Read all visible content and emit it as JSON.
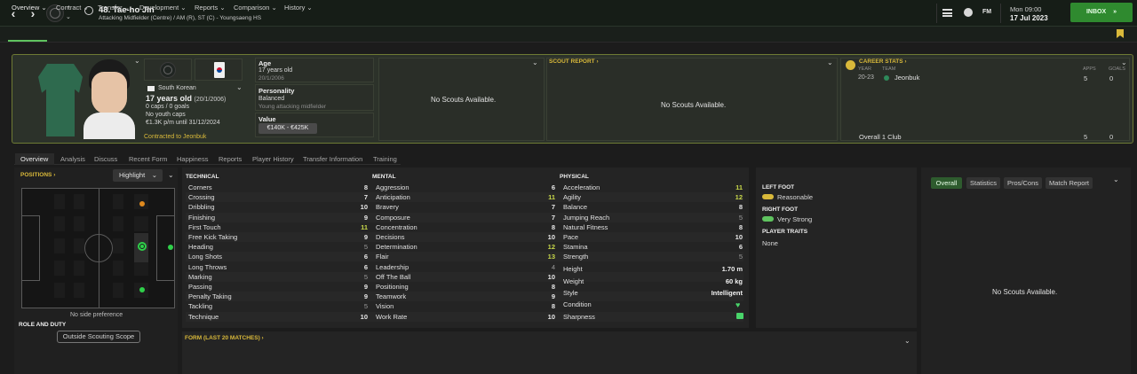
{
  "player": {
    "title": "48. Tae-ho Jin",
    "subtitle": "Attacking Midfielder (Centre) / AM (R), ST (C) - Youngsaeng HS",
    "nationality": "South Korean",
    "age_line": "17 years old",
    "dob_paren": "(20/1/2006)",
    "caps": "0 caps / 0 goals",
    "youth_caps": "No youth caps",
    "wage": "€1.3K p/m until 31/12/2024",
    "contracted": "Contracted to Jeonbuk"
  },
  "header": {
    "date_day": "Mon 09:00",
    "date_full": "17 Jul 2023",
    "inbox_label": "INBOX",
    "fm_label": "FM"
  },
  "menu": [
    "Overview",
    "Contract",
    "Transfer",
    "Development",
    "Reports",
    "Comparison",
    "History"
  ],
  "info": {
    "age_label": "Age",
    "age_value": "17 years old",
    "dob": "20/1/2006",
    "personality_label": "Personality",
    "personality_value": "Balanced",
    "personality_desc": "Young attacking midfielder",
    "value_label": "Value",
    "value_range": "€140K - €425K"
  },
  "scouts": {
    "no_scouts_1": "No Scouts Available.",
    "scout_report_label": "SCOUT REPORT",
    "no_scouts_2": "No Scouts Available.",
    "no_scouts_3": "No Scouts Available."
  },
  "career": {
    "label": "CAREER STATS",
    "col_year": "YEAR",
    "col_team": "TEAM",
    "col_apps": "APPS",
    "col_goals": "GOALS",
    "row_year": "20-23",
    "row_team": "Jeonbuk",
    "row_apps": "5",
    "row_goals": "0",
    "total_label": "Overall 1 Club",
    "total_apps": "5",
    "total_goals": "0"
  },
  "subtabs": [
    "Overview",
    "Analysis",
    "Discuss",
    "Recent Form",
    "Happiness",
    "Reports",
    "Player History",
    "Transfer Information",
    "Training"
  ],
  "positions": {
    "label": "POSITIONS",
    "highlight": "Highlight",
    "no_side": "No side preference",
    "role_label": "ROLE AND DUTY",
    "scope_button": "Outside Scouting Scope"
  },
  "attributes": {
    "technical_label": "TECHNICAL",
    "mental_label": "MENTAL",
    "physical_label": "PHYSICAL",
    "technical": [
      {
        "name": "Corners",
        "value": "8"
      },
      {
        "name": "Crossing",
        "value": "7"
      },
      {
        "name": "Dribbling",
        "value": "10"
      },
      {
        "name": "Finishing",
        "value": "9"
      },
      {
        "name": "First Touch",
        "value": "11"
      },
      {
        "name": "Free Kick Taking",
        "value": "9"
      },
      {
        "name": "Heading",
        "value": "5"
      },
      {
        "name": "Long Shots",
        "value": "6"
      },
      {
        "name": "Long Throws",
        "value": "6"
      },
      {
        "name": "Marking",
        "value": "5"
      },
      {
        "name": "Passing",
        "value": "9"
      },
      {
        "name": "Penalty Taking",
        "value": "9"
      },
      {
        "name": "Tackling",
        "value": "5"
      },
      {
        "name": "Technique",
        "value": "10"
      }
    ],
    "mental": [
      {
        "name": "Aggression",
        "value": "6"
      },
      {
        "name": "Anticipation",
        "value": "11"
      },
      {
        "name": "Bravery",
        "value": "7"
      },
      {
        "name": "Composure",
        "value": "7"
      },
      {
        "name": "Concentration",
        "value": "8"
      },
      {
        "name": "Decisions",
        "value": "10"
      },
      {
        "name": "Determination",
        "value": "12"
      },
      {
        "name": "Flair",
        "value": "13"
      },
      {
        "name": "Leadership",
        "value": "4"
      },
      {
        "name": "Off The Ball",
        "value": "10"
      },
      {
        "name": "Positioning",
        "value": "8"
      },
      {
        "name": "Teamwork",
        "value": "9"
      },
      {
        "name": "Vision",
        "value": "8"
      },
      {
        "name": "Work Rate",
        "value": "10"
      }
    ],
    "physical": [
      {
        "name": "Acceleration",
        "value": "11"
      },
      {
        "name": "Agility",
        "value": "12"
      },
      {
        "name": "Balance",
        "value": "8"
      },
      {
        "name": "Jumping Reach",
        "value": "5"
      },
      {
        "name": "Natural Fitness",
        "value": "8"
      },
      {
        "name": "Pace",
        "value": "10"
      },
      {
        "name": "Stamina",
        "value": "6"
      },
      {
        "name": "Strength",
        "value": "5"
      }
    ],
    "extra": [
      {
        "name": "Height",
        "value": "1.70 m"
      },
      {
        "name": "Weight",
        "value": "60 kg"
      },
      {
        "name": "Style",
        "value": "Intelligent"
      },
      {
        "name": "Condition",
        "value": ""
      },
      {
        "name": "Sharpness",
        "value": ""
      }
    ]
  },
  "feet": {
    "left_label": "LEFT FOOT",
    "left_value": "Reasonable",
    "right_label": "RIGHT FOOT",
    "right_value": "Very Strong",
    "traits_label": "PLAYER TRAITS",
    "traits_value": "None"
  },
  "form": {
    "label": "FORM (LAST 20 MATCHES)"
  },
  "right_tabs": [
    "Overall",
    "Statistics",
    "Pros/Cons",
    "Match Report"
  ],
  "colors": {
    "accent_green": "#5fc35f",
    "highlight_yellow": "#d9b93a",
    "attribute_high": "#c8d84a"
  }
}
